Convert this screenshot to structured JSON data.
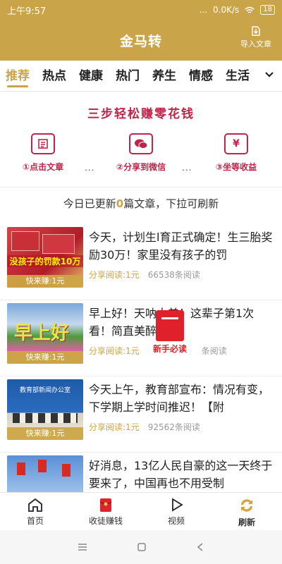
{
  "status_bar": {
    "time": "上午9:57",
    "dots": "...",
    "network_speed": "0.0K/s",
    "battery": "18"
  },
  "header": {
    "title": "金马转",
    "import_label": "导入文章"
  },
  "tabs": [
    {
      "label": "推荐",
      "active": true
    },
    {
      "label": "热点",
      "active": false
    },
    {
      "label": "健康",
      "active": false
    },
    {
      "label": "热门",
      "active": false
    },
    {
      "label": "养生",
      "active": false
    },
    {
      "label": "情感",
      "active": false
    },
    {
      "label": "生活",
      "active": false
    }
  ],
  "promo": {
    "title": "三步轻松赚零花钱",
    "dots": "...",
    "steps": [
      {
        "label": "①点击文章",
        "icon": "article-icon"
      },
      {
        "label": "②分享到微信",
        "icon": "wechat-icon"
      },
      {
        "label": "③坐等收益",
        "icon": "yen-icon",
        "glyph": "¥"
      }
    ]
  },
  "refresh_note": {
    "prefix": "今日已更新",
    "count": "0",
    "suffix": "篇文章，下拉可刷新"
  },
  "feed": [
    {
      "title": "今天，计划生l育正式确定！生三胎奖励30万！家里没有孩子的罚",
      "share": "分享阅读:1元",
      "reads": "66538条阅读",
      "badge": "快来赚:1元",
      "image_text": "没孩子的罚款10万"
    },
    {
      "title": "早上好！天呐太美！这辈子第1次看！简直美醉！",
      "share": "分享阅读:1元",
      "reads": "条阅读",
      "badge": "快来赚:1元",
      "image_text": "早上好"
    },
    {
      "title": "今天上午，教育部宣布：情况有变，下学期上学时间推迟！【附",
      "share": "分享阅读:1元",
      "reads": "92562条阅读",
      "badge": "快来赚:1元",
      "image_text": "教育部新闻办公室"
    },
    {
      "title": "好消息，13亿人民自豪的这一天终于要来了，中国再也不用受制",
      "share": "",
      "reads": "",
      "badge": "",
      "image_text": ""
    }
  ],
  "newbie": {
    "label": "新手必读"
  },
  "bottom_nav": [
    {
      "label": "首页",
      "icon": "home-icon"
    },
    {
      "label": "收徒赚钱",
      "icon": "red-envelope-icon"
    },
    {
      "label": "视频",
      "icon": "play-icon"
    },
    {
      "label": "刷新",
      "icon": "refresh-icon"
    }
  ],
  "colors": {
    "accent": "#c9a449",
    "promo": "#c0244a",
    "newbie": "#e0202a"
  }
}
